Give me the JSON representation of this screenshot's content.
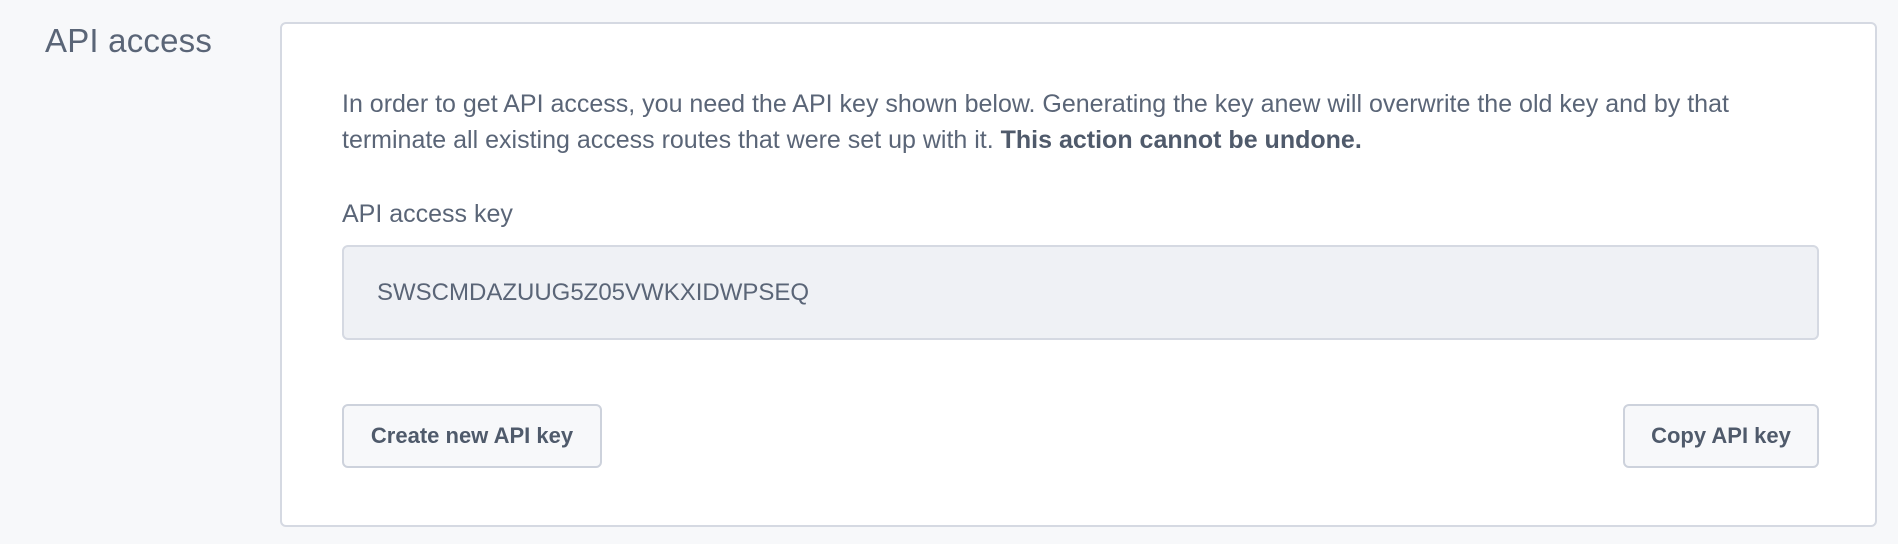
{
  "section": {
    "title": "API access"
  },
  "card": {
    "description_text": "In order to get API access, you need the API key shown below. Generating the key anew will overwrite the old key and by that terminate all existing access routes that were set up with it. ",
    "description_warning": "This action cannot be undone.",
    "field_label": "API access key",
    "api_key_value": "SWSCMDAZUUG5Z05VWKXIDWPSEQ",
    "create_button_label": "Create new API key",
    "copy_button_label": "Copy API key"
  }
}
